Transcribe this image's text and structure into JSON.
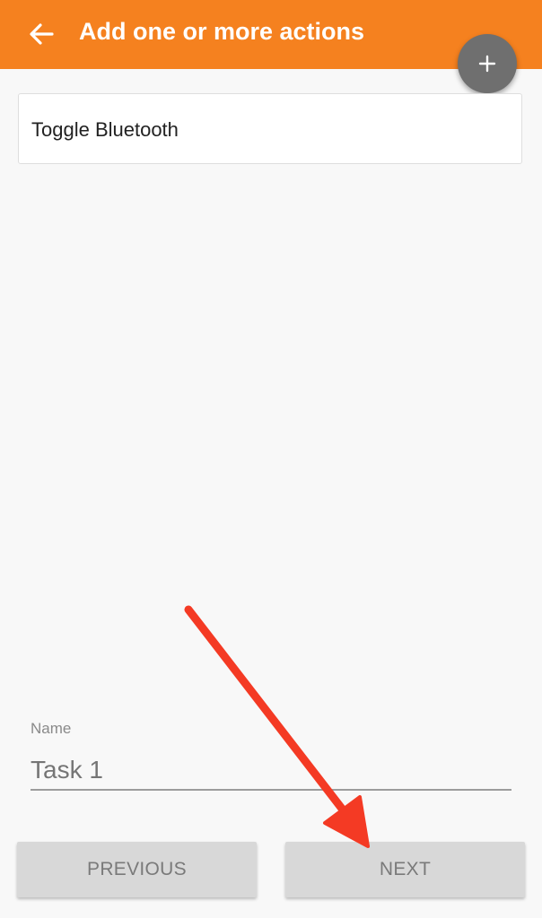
{
  "header": {
    "title": "Add one or more actions",
    "back_icon": "arrow-left-icon",
    "add_icon": "plus-icon",
    "color": "#f5811f"
  },
  "actions": [
    {
      "label": "Toggle Bluetooth"
    }
  ],
  "name_field": {
    "label": "Name",
    "value": "Task 1"
  },
  "footer": {
    "previous_label": "PREVIOUS",
    "next_label": "NEXT"
  },
  "annotation": {
    "arrow_color": "#f43a24"
  }
}
